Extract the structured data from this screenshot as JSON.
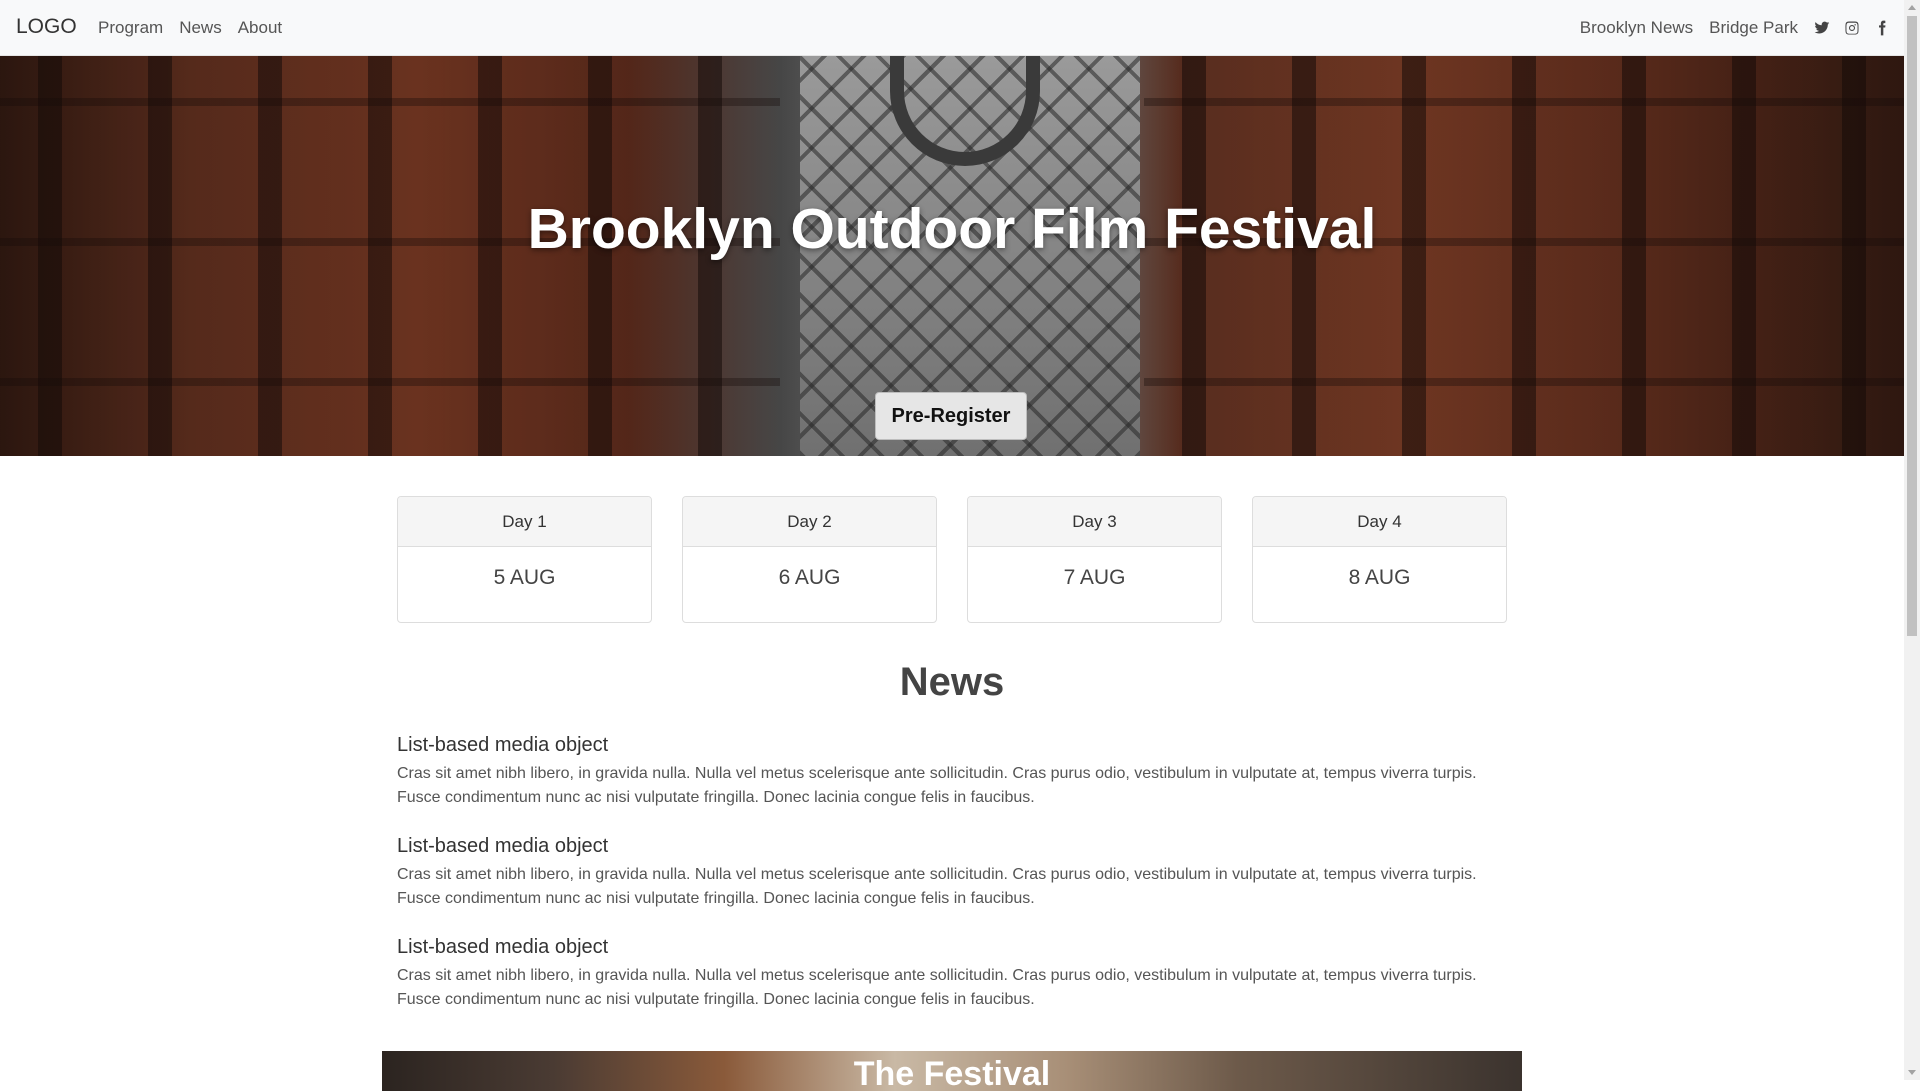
{
  "navbar": {
    "brand": "LOGO",
    "left_links": [
      "Program",
      "News",
      "About"
    ],
    "right_links": [
      "Brooklyn News",
      "Bridge Park"
    ],
    "social_icons": [
      "twitter-icon",
      "instagram-icon",
      "facebook-icon"
    ]
  },
  "hero": {
    "title": "Brooklyn Outdoor Film Festival",
    "button_label": "Pre-Register"
  },
  "days": [
    {
      "label": "Day 1",
      "date": "5 AUG"
    },
    {
      "label": "Day 2",
      "date": "6 AUG"
    },
    {
      "label": "Day 3",
      "date": "7 AUG"
    },
    {
      "label": "Day 4",
      "date": "8 AUG"
    }
  ],
  "news": {
    "title": "News",
    "items": [
      {
        "heading": "List-based media object",
        "body": "Cras sit amet nibh libero, in gravida nulla. Nulla vel metus scelerisque ante sollicitudin. Cras purus odio, vestibulum in vulputate at, tempus viverra turpis. Fusce condimentum nunc ac nisi vulputate fringilla. Donec lacinia congue felis in faucibus."
      },
      {
        "heading": "List-based media object",
        "body": "Cras sit amet nibh libero, in gravida nulla. Nulla vel metus scelerisque ante sollicitudin. Cras purus odio, vestibulum in vulputate at, tempus viverra turpis. Fusce condimentum nunc ac nisi vulputate fringilla. Donec lacinia congue felis in faucibus."
      },
      {
        "heading": "List-based media object",
        "body": "Cras sit amet nibh libero, in gravida nulla. Nulla vel metus scelerisque ante sollicitudin. Cras purus odio, vestibulum in vulputate at, tempus viverra turpis. Fusce condimentum nunc ac nisi vulputate fringilla. Donec lacinia congue felis in faucibus."
      }
    ]
  },
  "festival": {
    "title": "The Festival"
  }
}
